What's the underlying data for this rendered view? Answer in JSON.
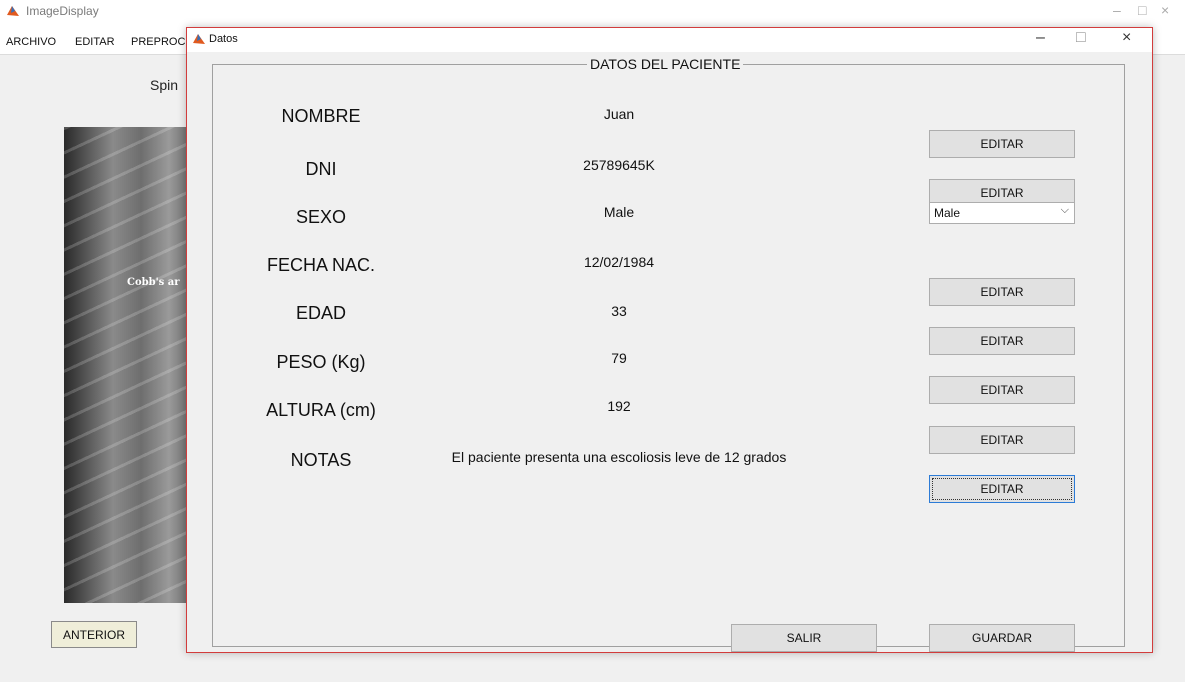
{
  "background_window": {
    "title": "ImageDisplay",
    "menu": [
      "ARCHIVO",
      "EDITAR",
      "PREPROCE"
    ],
    "label_partial": "Spin",
    "xray_caption": "Cobb's ar",
    "anterior_button": "ANTERIOR",
    "controls": {
      "minimize": "–",
      "maximize": "□",
      "close": "×"
    }
  },
  "dialog": {
    "title": "Datos",
    "controls": {
      "minimize": "–",
      "maximize": "□",
      "close": "×"
    },
    "panel_title": "DATOS DEL PACIENTE",
    "rows": [
      {
        "label": "NOMBRE",
        "value": "Juan",
        "action": "EDITAR"
      },
      {
        "label": "DNI",
        "value": "25789645K",
        "action": "EDITAR"
      },
      {
        "label": "SEXO",
        "value": "Male",
        "select_value": "Male"
      },
      {
        "label": "FECHA NAC.",
        "value": "12/02/1984",
        "action": "EDITAR"
      },
      {
        "label": "EDAD",
        "value": "33",
        "action": "EDITAR"
      },
      {
        "label": "PESO (Kg)",
        "value": "79",
        "action": "EDITAR"
      },
      {
        "label": "ALTURA (cm)",
        "value": "192",
        "action": "EDITAR"
      },
      {
        "label": "NOTAS",
        "value": "El paciente presenta una escoliosis leve de 12 grados",
        "action": "EDITAR"
      }
    ],
    "salir_button": "SALIR",
    "guardar_button": "GUARDAR"
  },
  "colors": {
    "dialog_border": "#d23c3c",
    "button_bg": "#e1e1e1",
    "anterior_bg": "#efeed9"
  }
}
